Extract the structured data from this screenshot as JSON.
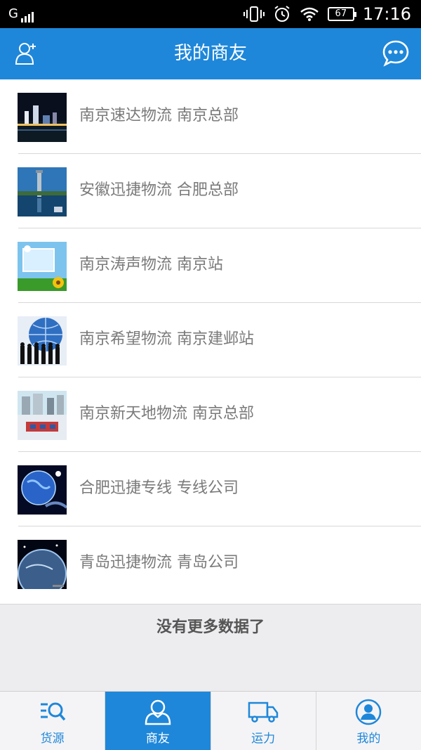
{
  "status_bar": {
    "network": "G",
    "battery": "67",
    "time": "17:16"
  },
  "header": {
    "title": "我的商友",
    "left_icon": "add-contact-icon",
    "right_icon": "chat-bubble-icon"
  },
  "contacts": [
    {
      "label": "南京速达物流 南京总部",
      "thumb": "night-city-skyline"
    },
    {
      "label": "安徽迅捷物流 合肥总部",
      "thumb": "lake-tower"
    },
    {
      "label": "南京涛声物流 南京站",
      "thumb": "sky-screen-sunflower"
    },
    {
      "label": "南京希望物流 南京建邺站",
      "thumb": "globe-business-people"
    },
    {
      "label": "南京新天地物流 南京总部",
      "thumb": "city-square"
    },
    {
      "label": "合肥迅捷专线 专线公司",
      "thumb": "earth-space-blue"
    },
    {
      "label": "青岛迅捷物流 青岛公司",
      "thumb": "earth-horizon-dark"
    }
  ],
  "footer_message": "没有更多数据了",
  "bottom_nav": [
    {
      "label": "货源",
      "icon": "list-search-icon",
      "active": false
    },
    {
      "label": "商友",
      "icon": "person-icon",
      "active": true
    },
    {
      "label": "运力",
      "icon": "truck-icon",
      "active": false
    },
    {
      "label": "我的",
      "icon": "profile-icon",
      "active": false
    }
  ],
  "colors": {
    "accent": "#1e87da",
    "text_muted": "#7a7a7a"
  }
}
